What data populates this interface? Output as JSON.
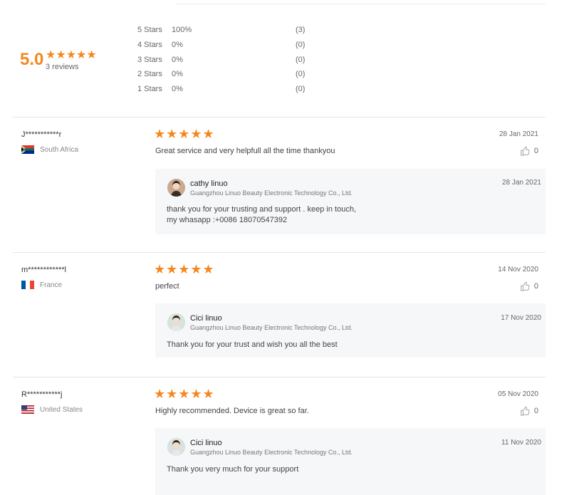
{
  "summary": {
    "average": "5.0",
    "stars": "★★★★★",
    "review_count": "3 reviews",
    "distribution": [
      {
        "label": "5 Stars",
        "percent": "100%",
        "count": "(3)"
      },
      {
        "label": "4 Stars",
        "percent": "0%",
        "count": "(0)"
      },
      {
        "label": "3 Stars",
        "percent": "0%",
        "count": "(0)"
      },
      {
        "label": "2 Stars",
        "percent": "0%",
        "count": "(0)"
      },
      {
        "label": "1 Stars",
        "percent": "0%",
        "count": "(0)"
      }
    ]
  },
  "colors": {
    "accent": "#f5871f",
    "reply_bg": "#f6f7f9"
  },
  "reviews": [
    {
      "name": "J***********r",
      "country": "South Africa",
      "flag": "south-africa-flag",
      "stars": "★★★★★",
      "date": "28 Jan 2021",
      "text": "Great service and very helpfull all the time thankyou",
      "likes": "0",
      "reply": {
        "name": "cathy linuo",
        "company": "Guangzhou Linuo Beauty Electronic Technology Co., Ltd.",
        "date": "28 Jan 2021",
        "text": "thank you for your trusting and  support . keep in touch,\nmy whasapp :+0086 18070547392"
      }
    },
    {
      "name": "m************l",
      "country": "France",
      "flag": "france-flag",
      "stars": "★★★★★",
      "date": "14 Nov 2020",
      "text": "perfect",
      "likes": "0",
      "reply": {
        "name": "Cici linuo",
        "company": "Guangzhou Linuo Beauty Electronic Technology Co., Ltd.",
        "date": "17 Nov 2020",
        "text": "Thank you for your trust and wish you all the best"
      }
    },
    {
      "name": "R***********j",
      "country": "United States",
      "flag": "united-states-flag",
      "stars": "★★★★★",
      "date": "05 Nov 2020",
      "text": "Highly recommended. Device is great so far.",
      "likes": "0",
      "reply": {
        "name": "Cici linuo",
        "company": "Guangzhou Linuo Beauty Electronic Technology Co., Ltd.",
        "date": "11 Nov 2020",
        "text": "Thank you very much for your support"
      }
    }
  ]
}
